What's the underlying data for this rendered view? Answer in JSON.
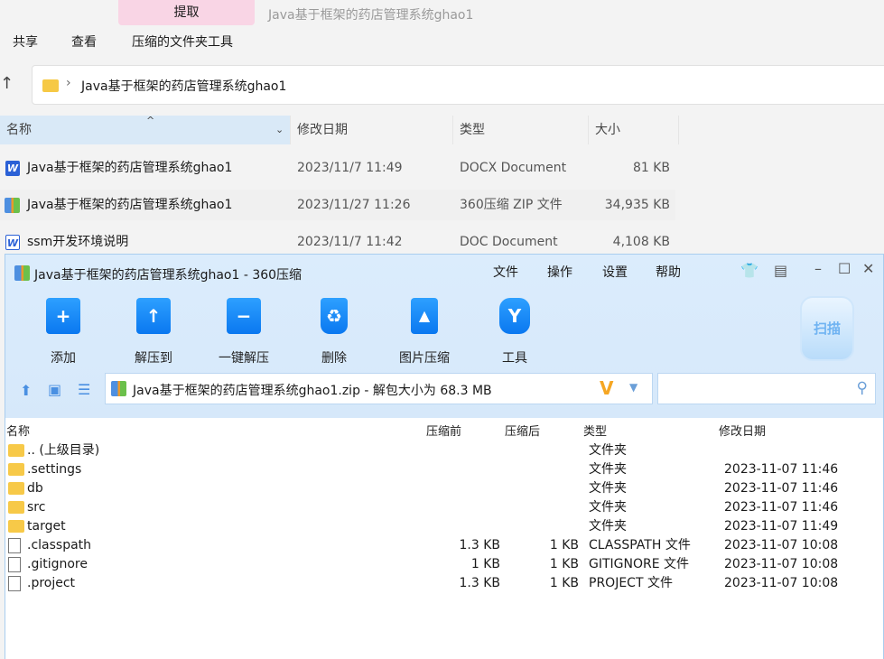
{
  "explorer": {
    "ribbon_tab": "提取",
    "window_title": "Java基于框架的药店管理系统ghao1",
    "menu": [
      "共享",
      "查看",
      "压缩的文件夹工具"
    ],
    "address": "Java基于框架的药店管理系统ghao1",
    "columns": [
      "名称",
      "修改日期",
      "类型",
      "大小"
    ],
    "files": [
      {
        "name": "Java基于框架的药店管理系统ghao1",
        "date": "2023/11/7 11:49",
        "type": "DOCX Document",
        "size": "81 KB"
      },
      {
        "name": "Java基于框架的药店管理系统ghao1",
        "date": "2023/11/27 11:26",
        "type": "360压缩 ZIP 文件",
        "size": "34,935 KB"
      },
      {
        "name": "ssm开发环境说明",
        "date": "2023/11/7 11:42",
        "type": "DOC Document",
        "size": "4,108 KB"
      }
    ]
  },
  "zip": {
    "title": "Java基于框架的药店管理系统ghao1 - 360压缩",
    "menu": [
      "文件",
      "操作",
      "设置",
      "帮助"
    ],
    "tools": [
      "添加",
      "解压到",
      "一键解压",
      "删除",
      "图片压缩",
      "工具"
    ],
    "scan": "扫描",
    "path": "Java基于框架的药店管理系统ghao1.zip - 解包大小为 68.3 MB",
    "columns": [
      "名称",
      "压缩前",
      "压缩后",
      "类型",
      "修改日期"
    ],
    "rows": [
      {
        "name": ".. (上级目录)",
        "before": "",
        "after": "",
        "type": "文件夹",
        "date": "",
        "kind": "folder"
      },
      {
        "name": ".settings",
        "before": "",
        "after": "",
        "type": "文件夹",
        "date": "2023-11-07 11:46",
        "kind": "folder"
      },
      {
        "name": "db",
        "before": "",
        "after": "",
        "type": "文件夹",
        "date": "2023-11-07 11:46",
        "kind": "folder"
      },
      {
        "name": "src",
        "before": "",
        "after": "",
        "type": "文件夹",
        "date": "2023-11-07 11:46",
        "kind": "folder"
      },
      {
        "name": "target",
        "before": "",
        "after": "",
        "type": "文件夹",
        "date": "2023-11-07 11:49",
        "kind": "folder"
      },
      {
        "name": ".classpath",
        "before": "1.3 KB",
        "after": "1 KB",
        "type": "CLASSPATH 文件",
        "date": "2023-11-07 10:08",
        "kind": "file"
      },
      {
        "name": ".gitignore",
        "before": "1 KB",
        "after": "1 KB",
        "type": "GITIGNORE 文件",
        "date": "2023-11-07 10:08",
        "kind": "file"
      },
      {
        "name": ".project",
        "before": "1.3 KB",
        "after": "1 KB",
        "type": "PROJECT 文件",
        "date": "2023-11-07 10:08",
        "kind": "file"
      }
    ]
  }
}
